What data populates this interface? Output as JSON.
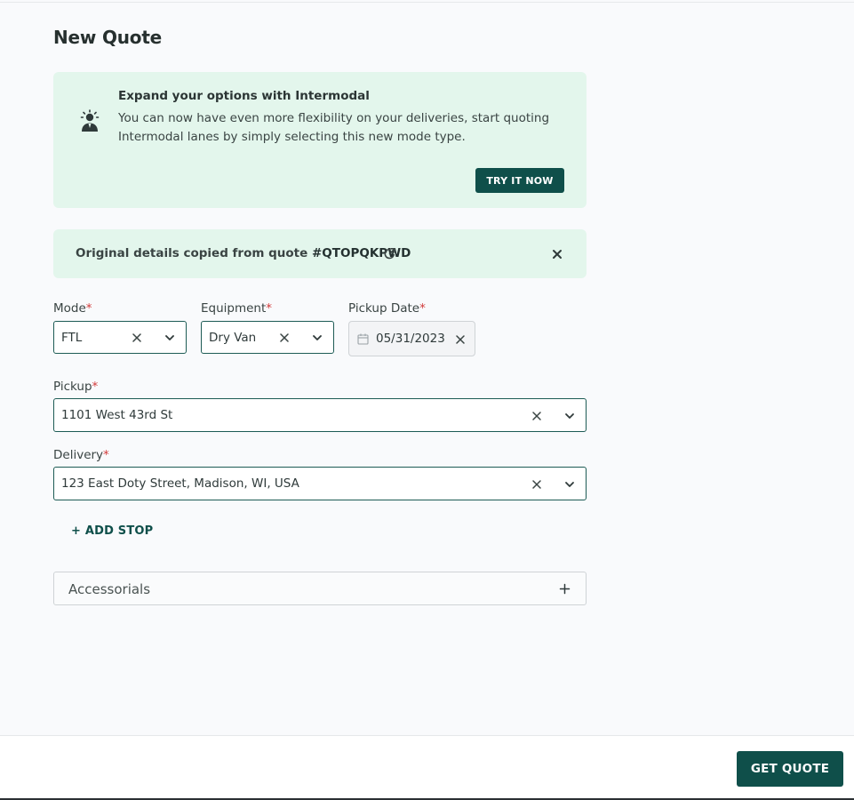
{
  "page": {
    "title": "New Quote"
  },
  "promo": {
    "title": "Expand your options with Intermodal",
    "text": "You can now have even more flexibility on your deliveries, start quoting Intermodal lanes by simply selecting this new mode type.",
    "button_label": "TRY IT NOW",
    "icon": "person-lightbulb-icon"
  },
  "notice": {
    "text_prefix": "Original details copied from quote ",
    "quote_id": "#QTOPQKPWD",
    "link_icon": "external-link-icon",
    "close_icon": "close-icon"
  },
  "form": {
    "mode": {
      "label": "Mode",
      "required": "*",
      "value": "FTL"
    },
    "equipment": {
      "label": "Equipment",
      "required": "*",
      "value": "Dry Van"
    },
    "pickup_date": {
      "label": "Pickup Date",
      "required": "*",
      "value": "05/31/2023"
    },
    "pickup": {
      "label": "Pickup",
      "required": "*",
      "value": "1101 West 43rd St"
    },
    "delivery": {
      "label": "Delivery",
      "required": "*",
      "value": "123 East Doty Street, Madison, WI, USA"
    },
    "add_stop_label": "+ ADD STOP",
    "accessorials": {
      "title": "Accessorials",
      "icon": "plus-icon"
    }
  },
  "footer": {
    "get_quote_label": "GET QUOTE"
  },
  "colors": {
    "primary": "#0f4f4a",
    "banner_bg": "#e3f6ec",
    "required": "#d23b3b",
    "field_border": "#1d5b55"
  }
}
